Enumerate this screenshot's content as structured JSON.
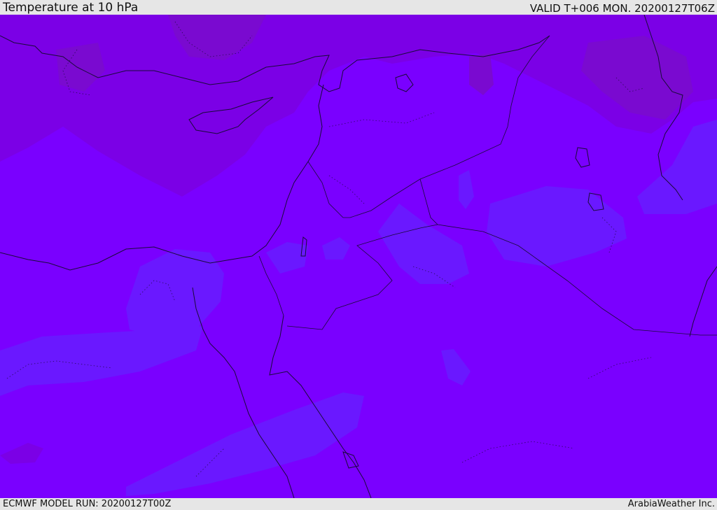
{
  "header": {
    "title": "Temperature at 10 hPa",
    "valid": "VALID T+006 MON. 20200127T06Z"
  },
  "footer": {
    "model_run": "ECMWF MODEL RUN: 20200127T00Z",
    "credit": "ArabiaWeather Inc."
  },
  "colors": {
    "field_base": "#7a00ff",
    "field_warm": "#7b00e6",
    "field_warmer": "#7a0ad0",
    "field_cool": "#6a18ff",
    "coastline": "#1a0a3a"
  }
}
